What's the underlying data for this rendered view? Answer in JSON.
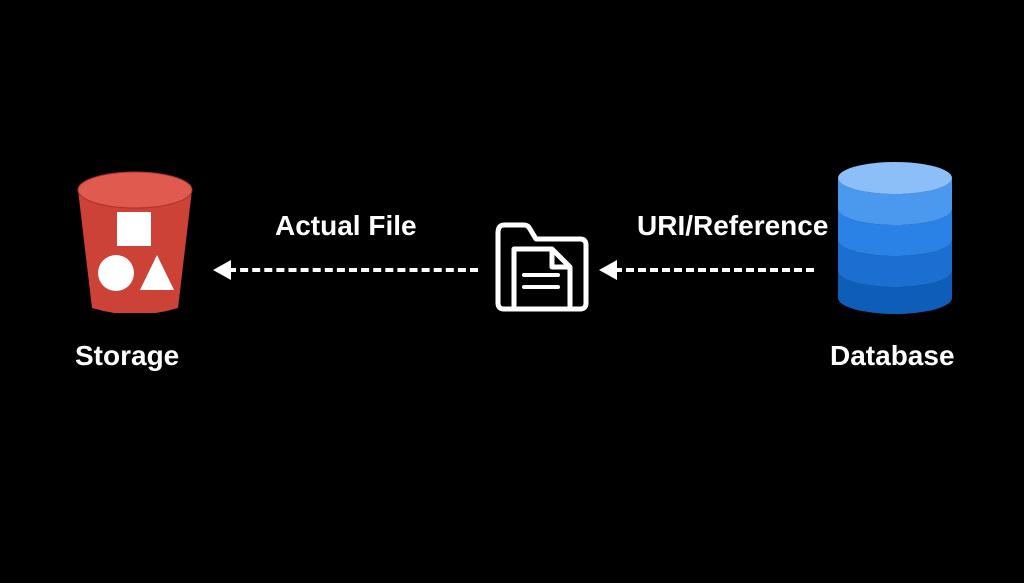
{
  "nodes": {
    "storage": {
      "label": "Storage",
      "icon": "bucket-icon",
      "color": "#d1473f"
    },
    "file": {
      "label": "",
      "icon": "folder-file-icon",
      "color": "#ffffff"
    },
    "database": {
      "label": "Database",
      "icon": "database-icon",
      "color": "#2d88f0"
    }
  },
  "edges": {
    "file_to_storage": {
      "label": "Actual File",
      "from": "file",
      "to": "storage",
      "direction": "left"
    },
    "database_to_file": {
      "label": "URI/Reference",
      "from": "database",
      "to": "file",
      "direction": "left"
    }
  }
}
